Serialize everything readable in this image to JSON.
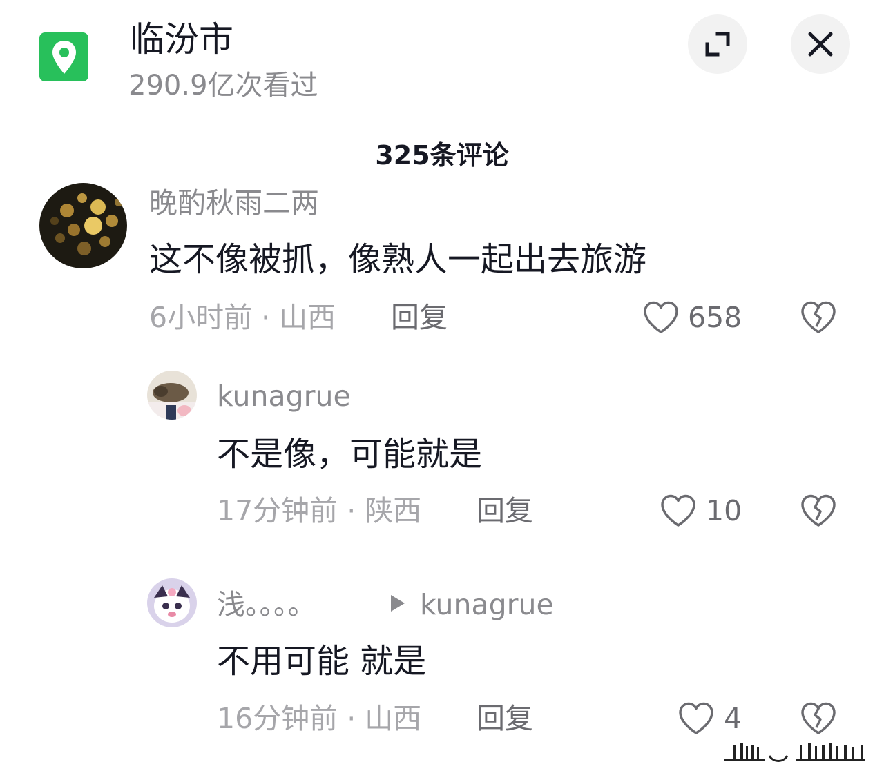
{
  "header": {
    "location_icon": "location-pin-icon",
    "title": "临汾市",
    "views": "290.9亿次看过",
    "expand_icon": "expand-icon",
    "close_icon": "close-icon",
    "accent_color": "#28c05b"
  },
  "comments_header": {
    "count_label": "325条评论"
  },
  "comments": [
    {
      "username": "晚酌秋雨二两",
      "text": "这不像被抓，像熟人一起出去旅游",
      "meta": "6小时前 · 山西",
      "reply_label": "回复",
      "likes": "658",
      "like_icon": "heart-outline-icon",
      "dislike_icon": "broken-heart-icon"
    },
    {
      "username": "kunagrue",
      "text": "不是像，可能就是",
      "meta": "17分钟前 · 陕西",
      "reply_label": "回复",
      "likes": "10",
      "like_icon": "heart-outline-icon",
      "dislike_icon": "broken-heart-icon"
    },
    {
      "username": "浅。。。。",
      "reply_to": "kunagrue",
      "text": "不用可能 就是",
      "meta": "16分钟前 · 山西",
      "reply_label": "回复",
      "likes": "4",
      "like_icon": "heart-outline-icon",
      "dislike_icon": "broken-heart-icon"
    }
  ]
}
